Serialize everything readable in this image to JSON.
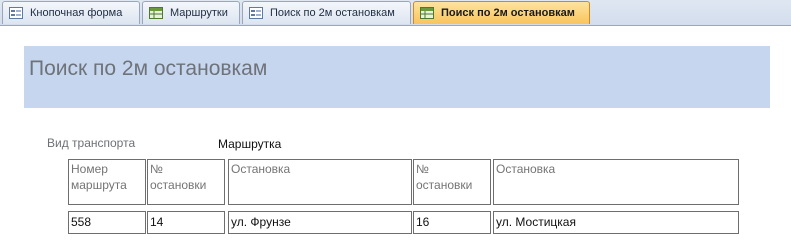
{
  "tabs": [
    {
      "label": "Кнопочная форма",
      "icon": "form-icon",
      "active": false
    },
    {
      "label": "Маршрутки",
      "icon": "table-icon",
      "active": false
    },
    {
      "label": "Поиск по 2м остановкам",
      "icon": "form-icon",
      "active": false
    },
    {
      "label": "Поиск по 2м остановкам",
      "icon": "query-icon",
      "active": true
    }
  ],
  "form": {
    "title": "Поиск по 2м остановкам",
    "transport_label": "Вид транспорта",
    "transport_value": "Маршрутка"
  },
  "table": {
    "headers": [
      "Номер маршрута",
      "№ остановки",
      "Остановка",
      "№ остановки",
      "Остановка"
    ],
    "rows": [
      [
        "558",
        "14",
        "ул. Фрунзе",
        "16",
        "ул. Мостицкая"
      ]
    ]
  },
  "colors": {
    "header_band": "#c6d6ee",
    "active_tab": "#f9c45c",
    "tab_accent": "#e89a2a"
  }
}
